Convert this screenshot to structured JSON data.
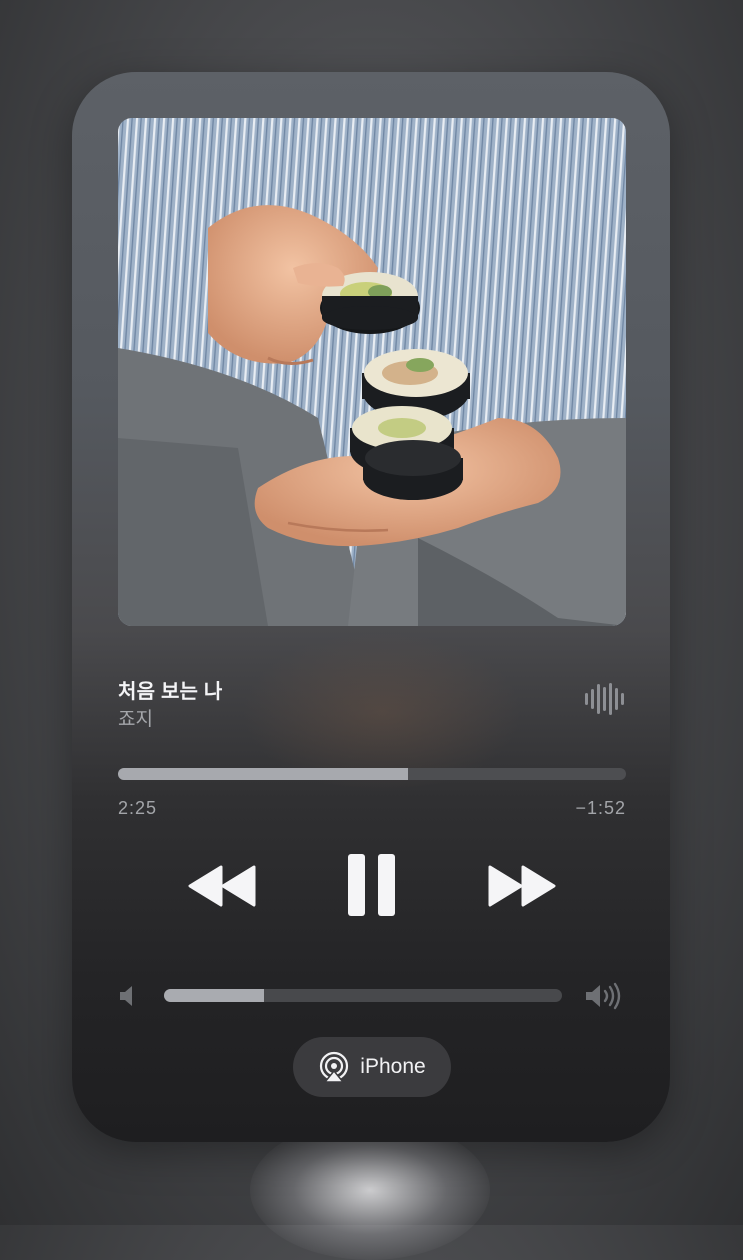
{
  "now_playing": {
    "title": "처음 보는 나",
    "artist": "죠지",
    "artwork_icon": "album-artwork",
    "progress_fraction": 0.57,
    "elapsed": "2:25",
    "remaining": "−1:52"
  },
  "controls": {
    "rewind_icon": "backward-icon",
    "play_pause_icon": "pause-icon",
    "forward_icon": "forward-icon",
    "waveform_icon": "waveform-icon"
  },
  "volume": {
    "level_fraction": 0.25,
    "low_icon": "speaker-low-icon",
    "high_icon": "speaker-high-icon"
  },
  "output": {
    "icon": "airplay-icon",
    "device": "iPhone"
  },
  "colors": {
    "progress_fill": "#a7a9ae",
    "progress_track": "#4d4e51",
    "text_primary": "#f4f4f6",
    "text_secondary": "#a5a7ab"
  }
}
